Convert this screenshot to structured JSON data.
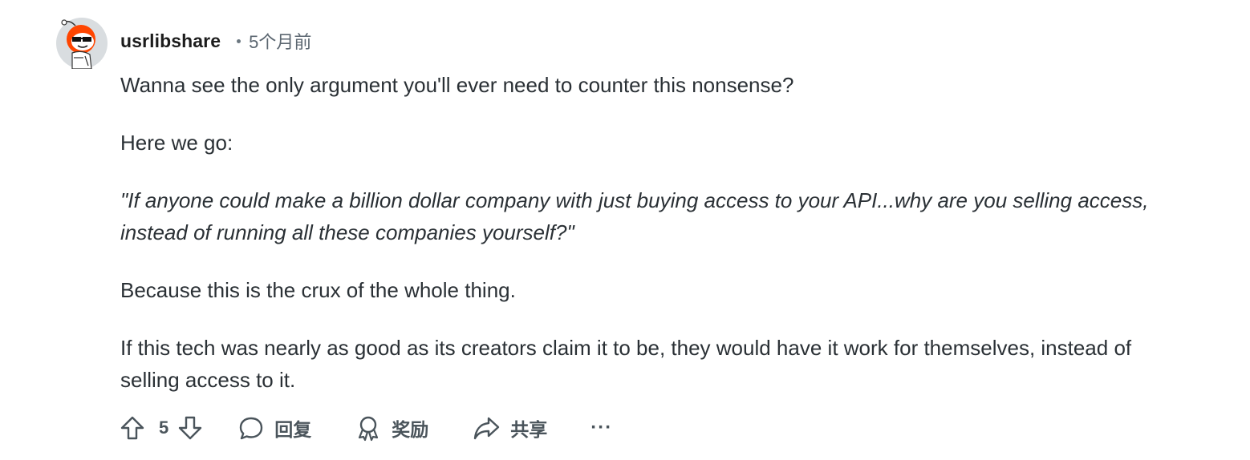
{
  "comment": {
    "username": "usrlibshare",
    "time": "5个月前",
    "paragraphs": [
      {
        "text": "Wanna see the only argument you'll ever need to counter this nonsense?",
        "italic": false
      },
      {
        "text": "Here we go:",
        "italic": false
      },
      {
        "text": "\"If anyone could make a billion dollar company with just buying access to your API...why are you selling access, instead of running all these companies yourself?\"",
        "italic": true
      },
      {
        "text": "Because this is the crux of the whole thing.",
        "italic": false
      },
      {
        "text": "If this tech was nearly as good as its creators claim it to be, they would have it work for themselves, instead of selling access to it.",
        "italic": false
      }
    ]
  },
  "actions": {
    "vote_count": "5",
    "reply_label": "回复",
    "award_label": "奖励",
    "share_label": "共享",
    "more_label": "···"
  },
  "colors": {
    "avatar_bg": "#d9dde0",
    "avatar_accent": "#ff4500",
    "action_text": "#4a545b"
  }
}
